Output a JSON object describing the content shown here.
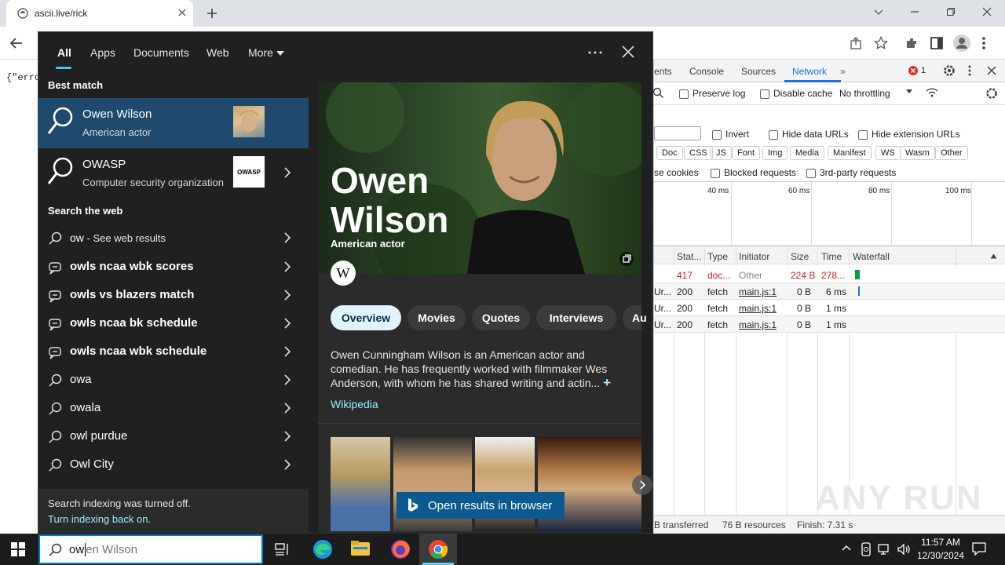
{
  "browser": {
    "tab_title": "ascii.live/rick",
    "page_text": "{\"erro"
  },
  "devtools": {
    "tabs": [
      "ents",
      "Console",
      "Sources",
      "Network"
    ],
    "error_count": "1",
    "preserve_log": "Preserve log",
    "disable_cache": "Disable cache",
    "throttling": "No throttling",
    "invert": "Invert",
    "hide_data_urls": "Hide data URLs",
    "hide_ext_urls": "Hide extension URLs",
    "filters": [
      "Doc",
      "CSS",
      "JS",
      "Font",
      "Img",
      "Media",
      "Manifest",
      "WS",
      "Wasm",
      "Other"
    ],
    "se_cookies": "se cookies",
    "blocked_requests": "Blocked requests",
    "third_party": "3rd-party requests",
    "timeline": [
      "40 ms",
      "60 ms",
      "80 ms",
      "100 ms"
    ],
    "columns": [
      "Stat...",
      "Type",
      "Initiator",
      "Size",
      "Time",
      "Waterfall"
    ],
    "rows": [
      {
        "name": "",
        "status": "417",
        "type": "doc...",
        "initiator": "Other",
        "size": "224 B",
        "time": "278..."
      },
      {
        "name": "Ur...",
        "status": "200",
        "type": "fetch",
        "initiator": "main.js:1",
        "size": "0 B",
        "time": "6 ms"
      },
      {
        "name": "Ur...",
        "status": "200",
        "type": "fetch",
        "initiator": "main.js:1",
        "size": "0 B",
        "time": "1 ms"
      },
      {
        "name": "Ur...",
        "status": "200",
        "type": "fetch",
        "initiator": "main.js:1",
        "size": "0 B",
        "time": "1 ms"
      }
    ],
    "status_transferred": "B transferred",
    "status_resources": "76 B resources",
    "status_finish": "Finish: 7.31 s"
  },
  "search": {
    "tabs": [
      "All",
      "Apps",
      "Documents",
      "Web",
      "More"
    ],
    "best_match_label": "Best match",
    "best_match": [
      {
        "title": "Owen Wilson",
        "subtitle": "American actor"
      },
      {
        "title": "OWASP",
        "subtitle": "Computer security organization",
        "thumb": "OWASP"
      }
    ],
    "web_label": "Search the web",
    "web_items": [
      {
        "text": "ow",
        "suffix": " - See web results",
        "bold": false,
        "icon": "search-icon"
      },
      {
        "text": "owls ncaa wbk scores",
        "bold": true,
        "icon": "trending-icon"
      },
      {
        "text": "owls vs blazers match",
        "bold": true,
        "icon": "trending-icon"
      },
      {
        "text": "owls ncaa bk schedule",
        "bold": true,
        "icon": "trending-icon"
      },
      {
        "text": "owls ncaa wbk schedule",
        "bold": true,
        "icon": "trending-icon"
      },
      {
        "text": "owa",
        "bold": false,
        "icon": "search-icon"
      },
      {
        "text": "owala",
        "bold": false,
        "icon": "search-icon"
      },
      {
        "text": "owl purdue",
        "bold": false,
        "icon": "search-icon"
      },
      {
        "text": "Owl City",
        "bold": false,
        "icon": "search-icon"
      }
    ],
    "indexing_off": "Search indexing was turned off.",
    "indexing_link": "Turn indexing back on.",
    "hero_name_1": "Owen",
    "hero_name_2": "Wilson",
    "hero_sub": "American actor",
    "pills": [
      "Overview",
      "Movies",
      "Quotes",
      "Interviews",
      "Au"
    ],
    "description": "Owen Cunningham Wilson is an American actor and comedian. He has frequently worked with filmmaker Wes Anderson, with whom he has shared writing and actin...",
    "source": "Wikipedia",
    "open_browser": "Open results in browser",
    "query_typed": "ow",
    "query_suggest": "en Wilson"
  },
  "taskbar": {
    "time": "11:57 AM",
    "date": "12/30/2024"
  },
  "watermark": "ANY RUN"
}
